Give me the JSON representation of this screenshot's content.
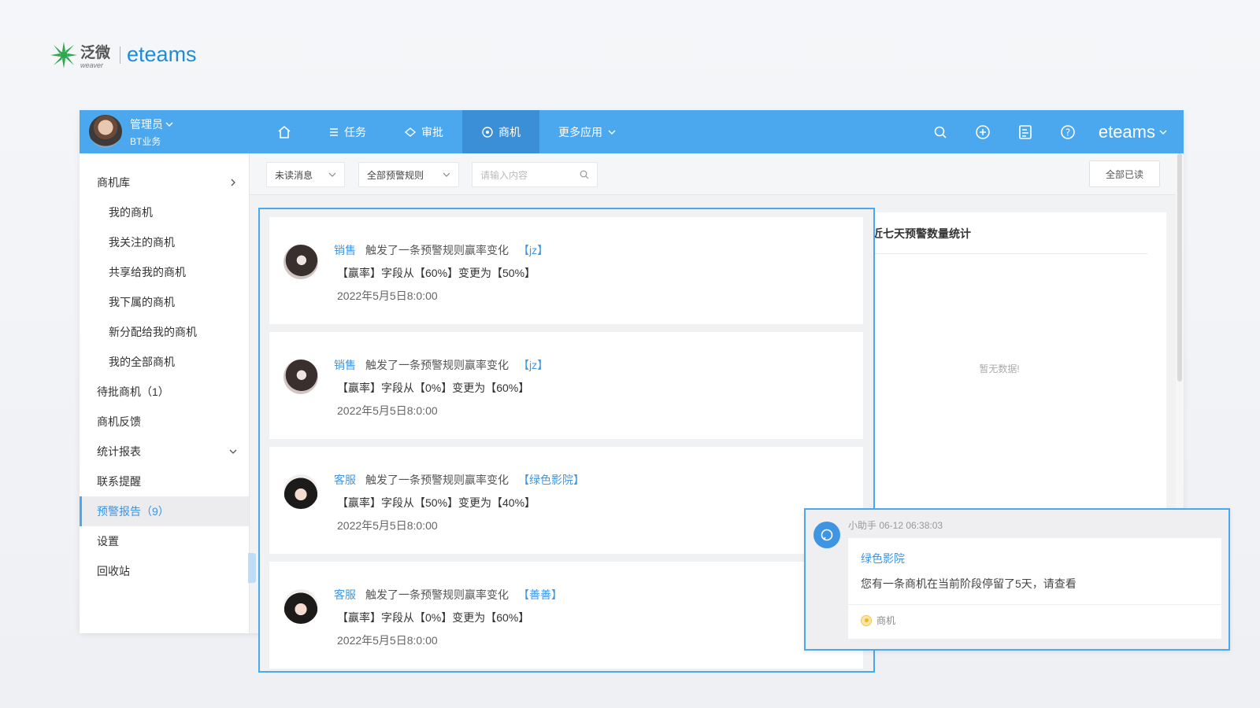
{
  "logo": {
    "cn": "泛微",
    "sub": "weaver",
    "en": "eteams"
  },
  "header": {
    "user_name": "管理员",
    "user_dept": "BT业务",
    "nav": [
      {
        "icon": "home-icon",
        "label": ""
      },
      {
        "icon": "list-icon",
        "label": "任务"
      },
      {
        "icon": "diamond-icon",
        "label": "审批"
      },
      {
        "icon": "opportunity-icon",
        "label": "商机"
      },
      {
        "icon": "chevron-down-icon",
        "label": "更多应用"
      }
    ],
    "brand": "eteams"
  },
  "sidebar": {
    "items": [
      {
        "label": "商机库"
      },
      {
        "label": "我的商机"
      },
      {
        "label": "我关注的商机"
      },
      {
        "label": "共享给我的商机"
      },
      {
        "label": "我下属的商机"
      },
      {
        "label": "新分配给我的商机"
      },
      {
        "label": "我的全部商机"
      },
      {
        "label": "待批商机（1）"
      },
      {
        "label": "商机反馈"
      },
      {
        "label": "统计报表"
      },
      {
        "label": "联系提醒"
      },
      {
        "label": "预警报告（9）"
      },
      {
        "label": "设置"
      },
      {
        "label": "回收站"
      }
    ]
  },
  "filters": {
    "status_select": "未读消息",
    "rule_select": "全部预警规则",
    "search_placeholder": "请输入内容",
    "read_all": "全部已读"
  },
  "stats_panel": {
    "title": "近七天预警数量统计",
    "empty": "暂无数据!"
  },
  "messages": [
    {
      "role": "销售",
      "text": "触发了一条预警规则赢率变化",
      "tag": "【jz】",
      "change": "【赢率】字段从【60%】变更为【50%】",
      "time": "2022年5月5日8:0:00"
    },
    {
      "role": "销售",
      "text": "触发了一条预警规则赢率变化",
      "tag": "【jz】",
      "change": "【赢率】字段从【0%】变更为【60%】",
      "time": "2022年5月5日8:0:00"
    },
    {
      "role": "客服",
      "text": "触发了一条预警规则赢率变化",
      "tag": "【绿色影院】",
      "change": "【赢率】字段从【50%】变更为【40%】",
      "time": "2022年5月5日8:0:00"
    },
    {
      "role": "客服",
      "text": "触发了一条预警规则赢率变化",
      "tag": "【善善】",
      "change": "【赢率】字段从【0%】变更为【60%】",
      "time": "2022年5月5日8:0:00"
    }
  ],
  "notification": {
    "meta": "小助手 06-12 06:38:03",
    "title": "绿色影院",
    "text": "您有一条商机在当前阶段停留了5天，请查看",
    "source": "商机"
  },
  "colors": {
    "primary": "#4ba7ee",
    "active_nav": "#3a8fd6",
    "link": "#3f97e3"
  }
}
